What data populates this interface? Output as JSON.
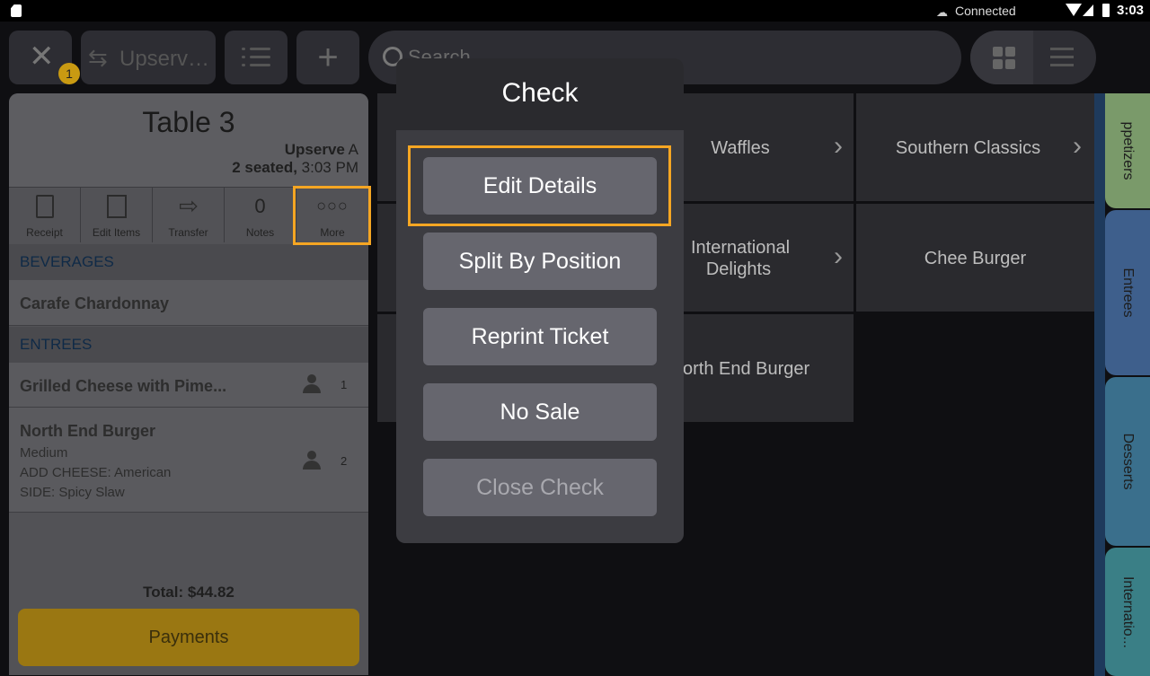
{
  "status_bar": {
    "connection": "Connected",
    "time": "3:03"
  },
  "toolbar": {
    "close_badge": "1",
    "upserve_label": "Upserve...",
    "search_placeholder": "Search"
  },
  "order": {
    "table_title": "Table 3",
    "server_name": "Upserve",
    "server_suffix": " A",
    "seated_count": "2 seated,",
    "seated_time": " 3:03 PM",
    "actions": [
      {
        "label": "Receipt"
      },
      {
        "label": "Edit Items"
      },
      {
        "label": "Transfer"
      },
      {
        "label": "Notes",
        "count": "0"
      },
      {
        "label": "More"
      }
    ],
    "sections": [
      {
        "title": "BEVERAGES"
      },
      {
        "title": "ENTREES"
      }
    ],
    "items": [
      {
        "name": "Carafe Chardonnay"
      },
      {
        "name": "Grilled Cheese with Pime...",
        "seat": "1"
      },
      {
        "name": "North End Burger",
        "seat": "2",
        "modifiers": [
          "Medium",
          "ADD CHEESE: American",
          "SIDE: Spicy Slaw"
        ]
      }
    ],
    "total": "Total: $44.82",
    "payments_label": "Payments"
  },
  "menu_grid": {
    "tiles": [
      {
        "label": "Waffles",
        "has_arrow": true
      },
      {
        "label": "Southern Classics",
        "has_arrow": true
      },
      {
        "label": "International Delights",
        "line1": "International",
        "line2": "Delights",
        "has_arrow": true
      },
      {
        "label": "Chee Burger",
        "has_arrow": false
      },
      {
        "label": "orth End Burger",
        "has_arrow": false
      }
    ]
  },
  "categories": [
    {
      "label": "ppetizers",
      "color": "#7a9a6a"
    },
    {
      "label": "Entrees",
      "color": "#3e5f8c"
    },
    {
      "label": "Desserts",
      "color": "#3a6f8c"
    },
    {
      "label": "Internatio...",
      "color": "#3a7f86"
    }
  ],
  "popup": {
    "title": "Check",
    "buttons": [
      {
        "label": "Edit Details"
      },
      {
        "label": "Split By Position"
      },
      {
        "label": "Reprint Ticket"
      },
      {
        "label": "No Sale"
      },
      {
        "label": "Close Check",
        "disabled": true
      }
    ]
  },
  "colors": {
    "highlight": "#f5a623",
    "payments": "#9a7712",
    "badge": "#c99a12"
  }
}
